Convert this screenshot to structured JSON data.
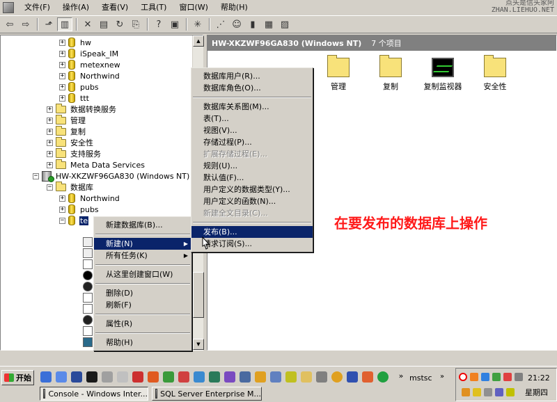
{
  "menubar": {
    "items": [
      "文件(F)",
      "操作(A)",
      "查看(V)",
      "工具(T)",
      "窗口(W)",
      "帮助(H)"
    ]
  },
  "watermark": {
    "line1": "点头是信头家阿",
    "line2": "ZHAN.LIEHUO.NET"
  },
  "tree": {
    "items": [
      {
        "label": "hw",
        "icon": "database-icon"
      },
      {
        "label": "iSpeak_IM",
        "icon": "database-icon"
      },
      {
        "label": "metexnew",
        "icon": "database-icon"
      },
      {
        "label": "Northwind",
        "icon": "database-icon"
      },
      {
        "label": "pubs",
        "icon": "database-icon"
      },
      {
        "label": "ttt",
        "icon": "database-icon"
      },
      {
        "label": "数据转换服务",
        "icon": "folder-icon"
      },
      {
        "label": "管理",
        "icon": "folder-icon"
      },
      {
        "label": "复制",
        "icon": "folder-icon"
      },
      {
        "label": "安全性",
        "icon": "folder-icon"
      },
      {
        "label": "支持服务",
        "icon": "folder-icon"
      },
      {
        "label": "Meta Data Services",
        "icon": "folder-icon"
      },
      {
        "label": "HW-XKZWF96GA830 (Windows NT)",
        "icon": "server-icon"
      },
      {
        "label": "数据库",
        "icon": "folder-icon"
      },
      {
        "label": "Northwind",
        "icon": "database-icon"
      },
      {
        "label": "pubs",
        "icon": "database-icon"
      },
      {
        "label": "te",
        "icon": "database-icon"
      }
    ]
  },
  "right_pane": {
    "title": "HW-XKZWF96GA830 (Windows NT)",
    "count": "7 个项目",
    "icons": [
      {
        "label": "管理",
        "icon": "folder-icon"
      },
      {
        "label": "复制",
        "icon": "folder-icon"
      },
      {
        "label": "复制监视器",
        "icon": "monitor-icon"
      },
      {
        "label": "安全性",
        "icon": "folder-icon"
      }
    ],
    "annotation": "在要发布的数据库上操作"
  },
  "context_menu": {
    "items": [
      "新建数据库(B)...",
      "新建(N)",
      "所有任务(K)",
      "从这里创建窗口(W)",
      "删除(D)",
      "刷新(F)",
      "属性(R)",
      "帮助(H)"
    ]
  },
  "submenu": {
    "items": [
      "数据库用户(R)...",
      "数据库角色(O)...",
      "数据库关系图(M)...",
      "表(T)...",
      "视图(V)...",
      "存储过程(P)...",
      "扩展存储过程(E)...",
      "规则(U)...",
      "默认值(F)...",
      "用户定义的数据类型(Y)...",
      "用户定义的函数(N)...",
      "新建全文目录(C)...",
      "发布(B)...",
      "请求订阅(S)..."
    ]
  },
  "taskbar": {
    "start": "开始",
    "mstsc": "mstsc",
    "clock": "21:22",
    "weekday": "星期四",
    "tasks": [
      "Console - Windows Inter...",
      "SQL Server Enterprise M..."
    ]
  },
  "colors": {
    "highlight": "#0a246a",
    "annotation": "#ff1a1a",
    "face": "#d4d0c8"
  }
}
